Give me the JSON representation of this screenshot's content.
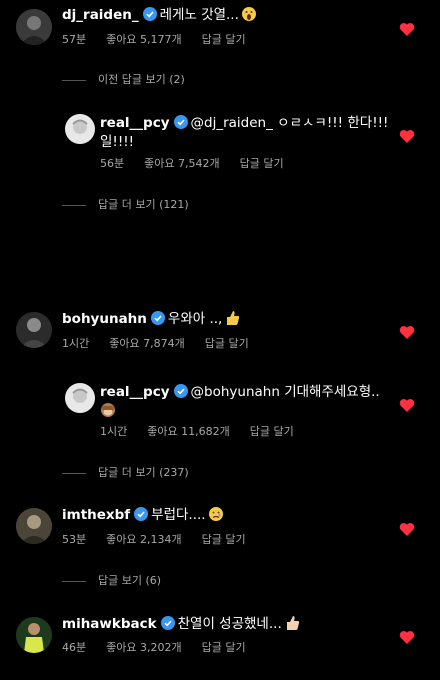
{
  "comments": [
    {
      "username": "dj_raiden_",
      "text": "레게노 갓열...",
      "emoji": "screaming-face-emoji",
      "time": "57분",
      "likes": "좋아요 5,177개",
      "reply": "답글 달기",
      "view_replies": "이전 답글 보기 (2)"
    },
    {
      "username": "real__pcy",
      "text_line1": "@dj_raiden_ ㅇㄹㅅㅋ!!! 한다!!!",
      "text_line2": "일!!!!",
      "time": "56분",
      "likes": "좋아요 7,542개",
      "reply": "답글 달기",
      "view_more": "답글 더 보기 (121)"
    },
    {
      "username": "bohyunahn",
      "text": "우와아 ..,",
      "emoji": "thumbs-up-emoji",
      "time": "1시간",
      "likes": "좋아요 7,874개",
      "reply": "답글 달기"
    },
    {
      "username": "real__pcy",
      "text": "@bohyunahn 기대해주세요형..",
      "emoji": "see-no-evil-monkey-emoji",
      "time": "1시간",
      "likes": "좋아요 11,682개",
      "reply": "답글 달기",
      "view_more": "답글 더 보기 (237)"
    },
    {
      "username": "imthexbf",
      "text": "부럽다....",
      "emoji": "crying-face-emoji",
      "time": "53분",
      "likes": "좋아요 2,134개",
      "reply": "답글 달기",
      "view_replies": "답글 보기 (6)"
    },
    {
      "username": "mihawkback",
      "text": "찬열이 성공했네...",
      "emoji": "thumbs-up-emoji",
      "time": "46분",
      "likes": "좋아요 3,202개",
      "reply": "답글 달기"
    }
  ],
  "colors": {
    "heart": "#ff3040",
    "verified": "#3897f0",
    "meta": "#a8a8a8"
  }
}
